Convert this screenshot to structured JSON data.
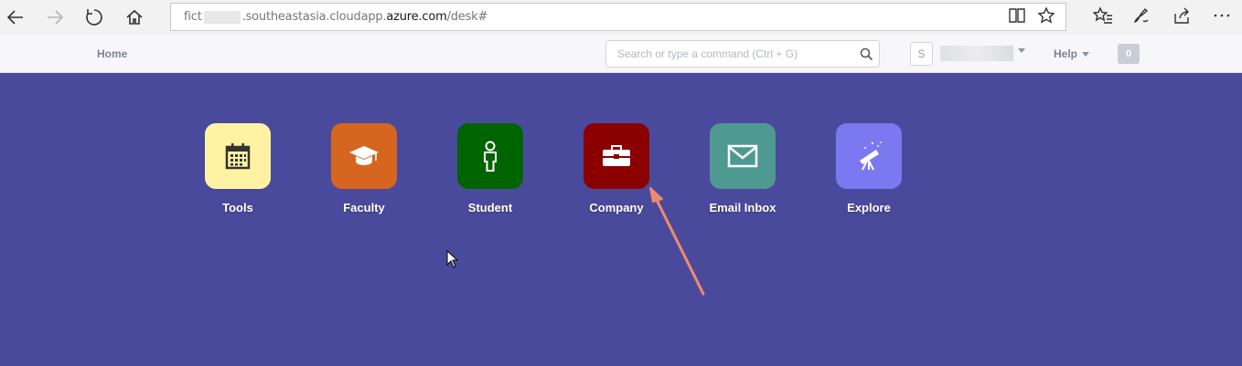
{
  "browser": {
    "url_prefix": "fict",
    "url_host": ".southeastasia.cloudapp.",
    "url_domain": "azure.com",
    "url_path": "/desk#",
    "icons": [
      "back-icon",
      "forward-icon",
      "refresh-icon",
      "home-icon",
      "reading-view-icon",
      "favorite-star-icon",
      "favorites-list-icon",
      "pen-icon",
      "share-icon",
      "more-icon"
    ]
  },
  "navbar": {
    "home_label": "Home",
    "search_placeholder": "Search or type a command (Ctrl + G)",
    "avatar_initial": "S",
    "help_label": "Help",
    "notification_count": "0"
  },
  "desk": {
    "items": [
      {
        "label": "Tools",
        "icon": "calendar-icon",
        "color": "#fff3a3"
      },
      {
        "label": "Faculty",
        "icon": "graduation-cap-icon",
        "color": "#d5651f"
      },
      {
        "label": "Student",
        "icon": "person-icon",
        "color": "#006400"
      },
      {
        "label": "Company",
        "icon": "briefcase-icon",
        "color": "#8b0000"
      },
      {
        "label": "Email Inbox",
        "icon": "envelope-icon",
        "color": "#4e9a92"
      },
      {
        "label": "Explore",
        "icon": "telescope-icon",
        "color": "#7b78f0"
      }
    ]
  },
  "colors": {
    "desk_background": "#4a4a9c",
    "annotation_arrow": "#f08a6e"
  }
}
